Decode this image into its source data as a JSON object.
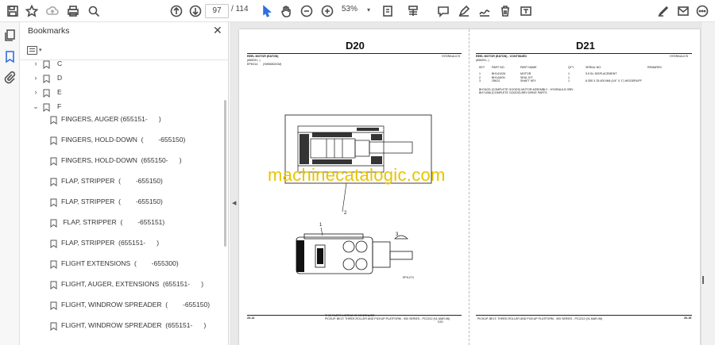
{
  "toolbar": {
    "current_page": "97",
    "total_pages": "/ 114",
    "zoom": "53%"
  },
  "bookmarks_panel": {
    "title": "Bookmarks",
    "close_glyph": "✕",
    "items": [
      {
        "label": "C",
        "toggle": "›"
      },
      {
        "label": "D",
        "toggle": "›"
      },
      {
        "label": "E",
        "toggle": "›"
      },
      {
        "label": "F",
        "toggle": "⌄"
      },
      {
        "label": "FINGERS, AUGER (655151-      )"
      },
      {
        "label": "FINGERS, HOLD-DOWN  (        -655150)"
      },
      {
        "label": "FINGERS, HOLD-DOWN  (655150-      )"
      },
      {
        "label": "FLAP, STRIPPER  (        -655150)"
      },
      {
        "label": "FLAP, STRIPPER  (        -655150)"
      },
      {
        "label": " FLAP, STRIPPER  (        -655151)"
      },
      {
        "label": "FLAP, STRIPPER  (655151-      )"
      },
      {
        "label": "FLIGHT EXTENSIONS  (        -655300)"
      },
      {
        "label": "FLIGHT, AUGER, EXTENSIONS  (655151-      )"
      },
      {
        "label": "FLIGHT, WINDROW SPREADER  (        -655150)"
      },
      {
        "label": "FLIGHT, WINDROW SPREADER  (655151-      )"
      }
    ]
  },
  "document": {
    "left_page": {
      "heading": "D20",
      "section": "HYDRAULICS",
      "title": "REEL MOTOR (EATON)",
      "serial": "(655291-      )",
      "sub": "EPH214",
      "sub2": "(SHB6502CM)",
      "fig_code": "EPIL274",
      "footer_left": "20-14",
      "footer_center": "THIS PARTS LISTING IS CONTINUED",
      "footer_center2": "PICKUP, BELT; THREE-ROLLER AND PICKUP PLATFORM - 900 SERIES - PC2212    (01-MAR-96)",
      "footer_right": "D20",
      "callouts": [
        "1",
        "2",
        "3"
      ]
    },
    "right_page": {
      "heading": "D21",
      "section": "HYDRAULICS",
      "title": "REEL MOTOR (EATON) - CONTINUED",
      "serial": "(655291-      )",
      "columns": [
        "KEY",
        "PART NO.",
        "PART NAME",
        "QTY",
        "SERIAL NO.",
        "REMARKS"
      ],
      "rows": [
        [
          "1",
          "BH141026",
          "MOTOR",
          "1",
          "",
          "5.9 IN. DISPLACEMENT"
        ],
        [
          "2",
          "BH144031",
          "SEAL KIT",
          "1",
          "",
          ""
        ],
        [
          "3",
          "25K22",
          "SHAFT KEY",
          "1",
          "",
          "6.350 X 25.400 MM (1/4\" X 1\") WOODRUFF"
        ]
      ],
      "notes": [
        "BH7AGS (COMPLETE GOODS) MOTOR ASSEMBLY - HYDRAULIC BRV",
        "BH71056 (COMPLETE GOODS) BRV DRIVE PARTS"
      ],
      "footer_left": "PICKUP, BELT; THREE-ROLLER AND PICKUP PLATFORM - 900 SERIES - PC2212    (01-MAR-96)",
      "footer_right": "20-15"
    },
    "watermark": "machinecatalogic.com"
  },
  "colors": {
    "accent_blue": "#2f6fe0",
    "watermark_yellow": "#e8c400",
    "doc_bg": "#e9e9e9"
  }
}
